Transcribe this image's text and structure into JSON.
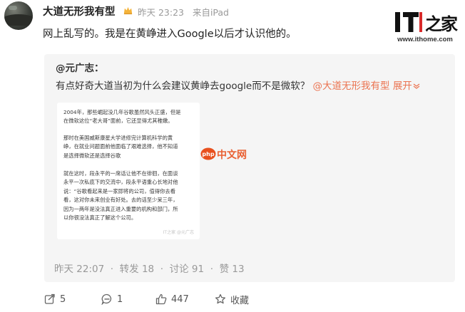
{
  "post": {
    "author": "大道无形我有型",
    "time": "昨天 23:23",
    "source": "来自iPad",
    "text": "网上乱写的。我是在黄峥进入Google以后才认识他的。"
  },
  "watermark_site": {
    "logo_text": "IT之家",
    "url": "www.ithome.com"
  },
  "repost": {
    "author": "@元广志：",
    "text": "有点好奇大道当初为什么会建议黄峥去google而不是微软？",
    "mention": "@大道无形我有型",
    "expand": "展开",
    "snapshot_paragraphs": [
      [
        "2004年，那些崛起没几年谷歌虽然风头正盛，但是",
        "在微软这位“老大哥”面前，它还显得尤其稚嫩。"
      ],
      [
        "那时在美国威斯康星大学进修完计算机科学的黄",
        "峥，在就业问题面前他面临了艰难选择，他不知道",
        "是选择微软还是选择谷歌"
      ],
      [
        "就在这时，段永平的一席话让他不在徘徊，在面谈",
        "永平一次私底下的交流中，段永平语重心长地对他",
        "说：“谷歌看起来是一家即将的公司，值得你去看",
        "看，这对你未来创业有好处。去的话至少呆三年，",
        "因为一两年是没法真正进入重要的机构和部门，所",
        "以你很没法真正了解这个公司。"
      ]
    ],
    "snapshot_footer": "IT之家 @元广志",
    "time": "昨天 22:07",
    "reposts": "转发 18",
    "comments": "讨论 91",
    "likes": "赞 13"
  },
  "php_watermark": {
    "text": "中文网"
  },
  "toolbar": {
    "repost_count": "5",
    "comment_count": "1",
    "like_count": "447",
    "fav_label": "收藏"
  },
  "colors": {
    "accent": "#eb7350",
    "meta": "#999999",
    "repost_bg": "#f5f5f5"
  }
}
